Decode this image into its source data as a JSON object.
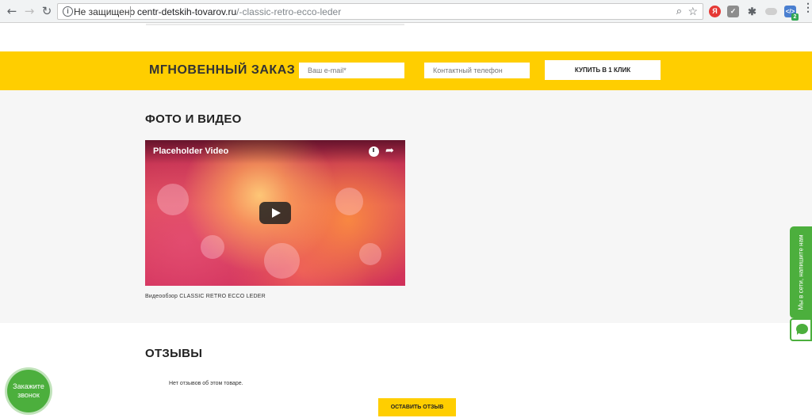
{
  "browser": {
    "security_label": "Не защищено",
    "url_host": "centr-detskih-tovarov.ru",
    "url_path": "/-classic-retro-ecco-leder",
    "icons": [
      "back-icon",
      "forward-icon",
      "reload-icon",
      "info-icon",
      "zoom-icon",
      "star-icon",
      "yandex-icon",
      "ext-icon",
      "puzzle-icon",
      "cloud-icon",
      "dev-icon",
      "menu-icon"
    ],
    "ext_yandex_letter": "Я",
    "ext_dev_badge": "2"
  },
  "quick_order": {
    "title": "МГНОВЕННЫЙ ЗАКАЗ",
    "email_placeholder": "Ваш e-mail*",
    "phone_placeholder": "Контактный телефон",
    "buy_button": "КУПИТЬ В 1 КЛИК",
    "accent_color": "#ffce00"
  },
  "media": {
    "section_title": "ФОТО И ВИДЕО",
    "video_title": "Placeholder Video",
    "video_caption": "Видеообзор CLASSIC RETRO ECCO LEDER"
  },
  "reviews": {
    "section_title": "ОТЗЫВЫ",
    "empty_text": "Нет отзывов об этом товаре.",
    "leave_review_button": "ОСТАВИТЬ ОТЗЫВ"
  },
  "widgets": {
    "callback_label": "Закажите звонок",
    "chat_tab_label": "Мы в сети, напишите нам",
    "widget_color": "#4caf3d"
  }
}
